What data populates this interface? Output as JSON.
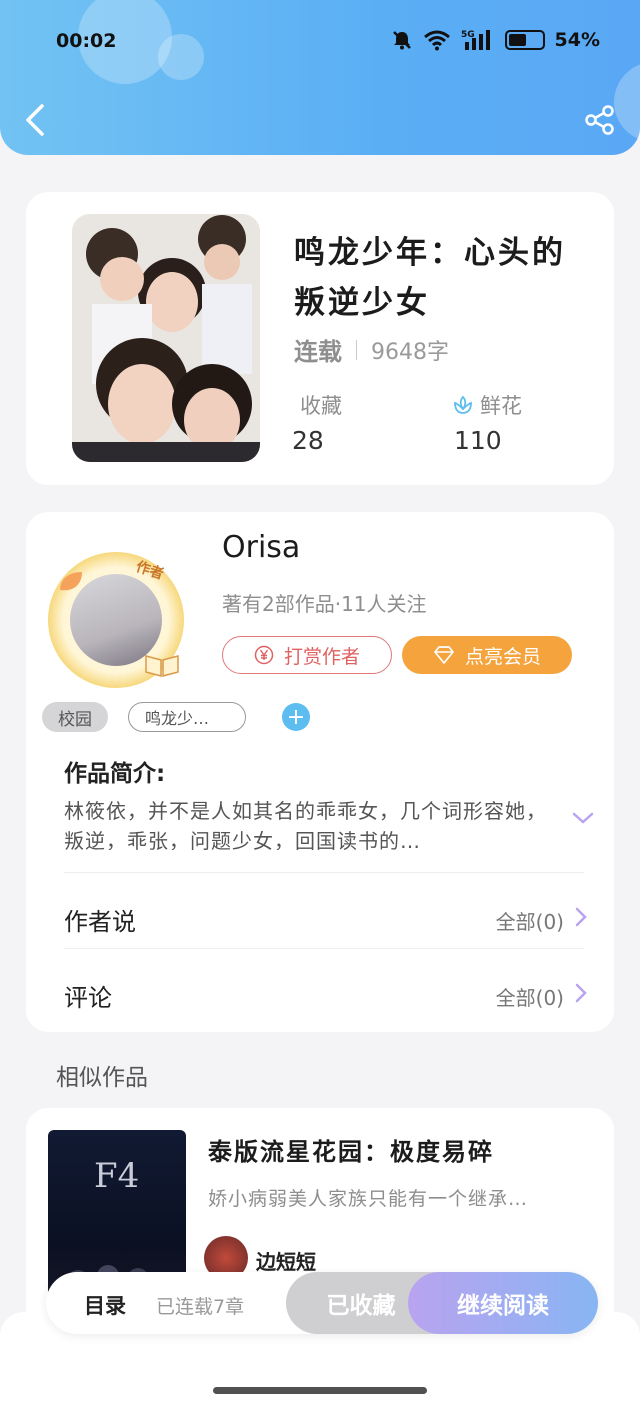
{
  "status_bar": {
    "time": "00:02",
    "battery": "54%",
    "battery_level": 0.54,
    "network": "5G"
  },
  "book": {
    "title": "鸣龙少年：心头的叛逆少女",
    "status": "连载",
    "word_count": "9648字",
    "collect_label": "收藏",
    "collect_count": "28",
    "flower_label": "鲜花",
    "flower_count": "110"
  },
  "author": {
    "name": "Orisa",
    "badge": "作者",
    "summary": "著有2部作品·11人关注",
    "reward_label": "打赏作者",
    "member_label": "点亮会员",
    "tags": [
      "校园",
      "鸣龙少…"
    ],
    "add_tag": "+"
  },
  "intro": {
    "label": "作品简介:",
    "text": "林筱依，并不是人如其名的乖乖女，几个词形容她，叛逆，乖张，问题少女，回国读书的…"
  },
  "rows": [
    {
      "label": "作者说",
      "value": "全部(0)"
    },
    {
      "label": "评论",
      "value": "全部(0)"
    }
  ],
  "similar": {
    "section_title": "相似作品",
    "cover_text": "F4",
    "title": "泰版流星花园：极度易碎",
    "desc": "娇小病弱美人家族只能有一个继承…",
    "author": "边短短"
  },
  "bottom_bar": {
    "toc": "目录",
    "chapters": "已连载7章",
    "collected": "已收藏",
    "continue": "继续阅读"
  },
  "colors": {
    "accent": "#5aaef4",
    "reward": "#e06262",
    "member": "#f5a33c",
    "tag_add": "#5dbdf1"
  }
}
